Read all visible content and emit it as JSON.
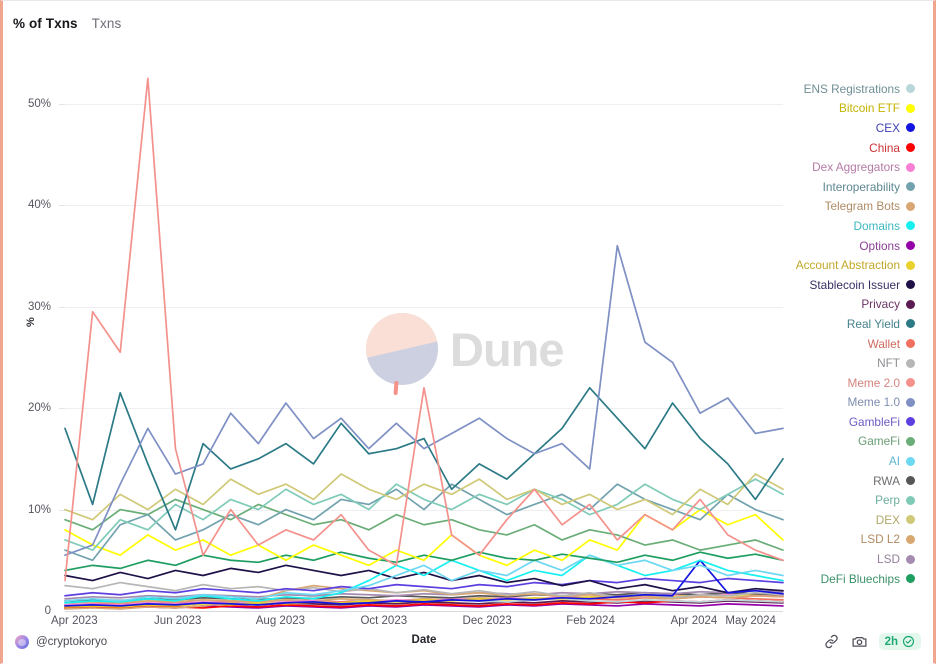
{
  "tabs": [
    {
      "label": "% of Txns",
      "active": true
    },
    {
      "label": "Txns",
      "active": false
    }
  ],
  "axes": {
    "y_label": "%",
    "x_label": "Date",
    "y_ticks": [
      "50%",
      "40%",
      "30%",
      "20%",
      "10%",
      "0"
    ],
    "x_ticks": [
      "Apr 2023",
      "Jun 2023",
      "Aug 2023",
      "Oct 2023",
      "Dec 2023",
      "Feb 2024",
      "Apr 2024",
      "May 2024"
    ]
  },
  "watermark": {
    "text": "Dune"
  },
  "footer": {
    "author": "@cryptokoryo",
    "avatar_icon": "avatar-icon",
    "share_icon": "share-link-icon",
    "camera_icon": "camera-icon",
    "freshness_label": "2h",
    "freshness_icon": "check-circle-icon"
  },
  "chart_data": {
    "type": "line",
    "title": "",
    "xlabel": "Date",
    "ylabel": "%",
    "ylim": [
      0,
      55
    ],
    "yticks": [
      0,
      10,
      20,
      30,
      40,
      50
    ],
    "grid": true,
    "legend_position": "right",
    "x": [
      "Apr 2023",
      "Apr 2023",
      "May 2023",
      "May 2023",
      "Jun 2023",
      "Jun 2023",
      "Jul 2023",
      "Jul 2023",
      "Aug 2023",
      "Aug 2023",
      "Sep 2023",
      "Sep 2023",
      "Oct 2023",
      "Oct 2023",
      "Nov 2023",
      "Nov 2023",
      "Dec 2023",
      "Dec 2023",
      "Jan 2024",
      "Jan 2024",
      "Feb 2024",
      "Feb 2024",
      "Mar 2024",
      "Mar 2024",
      "Apr 2024",
      "Apr 2024",
      "May 2024"
    ],
    "xtick_positions": [
      0.013,
      0.157,
      0.3,
      0.444,
      0.588,
      0.732,
      0.876,
      0.955
    ],
    "series": [
      {
        "name": "ENS Registrations",
        "color": "#b9d6da",
        "text_color": "#6f8f95",
        "values": [
          1.0,
          1.2,
          1.1,
          0.9,
          1.3,
          1.5,
          1.2,
          1.0,
          1.1,
          1.4,
          1.2,
          1.0,
          0.9,
          1.1,
          1.3,
          1.0,
          0.9,
          1.1,
          1.2,
          1.0,
          0.9,
          1.1,
          1.0,
          0.9,
          1.1,
          1.0,
          0.9
        ]
      },
      {
        "name": "Bitcoin ETF",
        "color": "#ffff00",
        "text_color": "#c3b400",
        "values": [
          8.0,
          6.5,
          5.5,
          7.5,
          6.0,
          7.0,
          5.5,
          6.5,
          5.0,
          6.5,
          5.5,
          4.5,
          6.0,
          5.0,
          7.5,
          5.5,
          4.5,
          6.0,
          5.0,
          7.0,
          6.0,
          9.5,
          8.0,
          10.0,
          8.5,
          9.5,
          7.0
        ]
      },
      {
        "name": "CEX",
        "color": "#1414e0",
        "text_color": "#3f3fb5",
        "values": [
          0.5,
          0.6,
          0.5,
          0.7,
          0.6,
          0.8,
          0.7,
          0.6,
          0.8,
          0.9,
          0.7,
          0.8,
          1.0,
          0.9,
          1.1,
          1.0,
          1.2,
          1.1,
          1.3,
          1.2,
          1.4,
          1.6,
          1.5,
          5.0,
          1.8,
          2.0,
          1.7
        ]
      },
      {
        "name": "China",
        "color": "#ff0000",
        "text_color": "#cc3333",
        "values": [
          0.3,
          0.4,
          0.3,
          0.5,
          0.4,
          0.3,
          0.5,
          0.4,
          0.6,
          0.5,
          0.4,
          0.6,
          0.5,
          0.7,
          0.6,
          0.5,
          0.7,
          0.6,
          0.8,
          0.7,
          0.9,
          0.8,
          1.0,
          0.9,
          1.1,
          1.0,
          0.9
        ]
      },
      {
        "name": "Dex Aggregators",
        "color": "#f97fd6",
        "text_color": "#b57ba5",
        "values": [
          0.6,
          0.7,
          0.6,
          0.8,
          0.7,
          0.9,
          0.8,
          0.7,
          0.9,
          1.0,
          0.8,
          0.9,
          1.1,
          1.0,
          1.2,
          1.1,
          1.3,
          1.2,
          1.4,
          1.3,
          1.5,
          1.4,
          1.6,
          1.5,
          1.7,
          1.6,
          1.5
        ]
      },
      {
        "name": "Interoperability",
        "color": "#72a2ae",
        "text_color": "#5d8792",
        "values": [
          6.0,
          5.0,
          8.5,
          9.5,
          7.0,
          8.0,
          9.5,
          8.5,
          10.0,
          9.0,
          11.0,
          10.5,
          12.0,
          10.0,
          12.5,
          11.0,
          9.5,
          10.5,
          11.5,
          10.0,
          12.5,
          11.0,
          10.0,
          9.0,
          11.5,
          10.0,
          9.0
        ]
      },
      {
        "name": "Telegram Bots",
        "color": "#d9a774",
        "text_color": "#b08c66",
        "values": [
          0.2,
          0.3,
          0.2,
          0.4,
          0.3,
          0.5,
          0.8,
          1.2,
          2.0,
          2.5,
          2.2,
          2.0,
          1.8,
          2.0,
          1.6,
          1.8,
          1.5,
          1.7,
          1.4,
          1.6,
          1.3,
          1.5,
          1.2,
          1.4,
          1.3,
          1.5,
          1.4
        ]
      },
      {
        "name": "Domains",
        "color": "#18f0f0",
        "text_color": "#3ab8bd",
        "values": [
          0.8,
          1.0,
          0.9,
          1.2,
          1.0,
          1.5,
          1.2,
          1.0,
          1.4,
          1.2,
          1.8,
          3.0,
          4.5,
          3.5,
          5.0,
          4.0,
          3.0,
          4.0,
          3.5,
          5.5,
          4.5,
          3.5,
          4.0,
          5.0,
          4.0,
          3.5,
          3.0
        ]
      },
      {
        "name": "Options",
        "color": "#9400a8",
        "text_color": "#8a3f95",
        "values": [
          0.3,
          0.4,
          0.3,
          0.4,
          0.3,
          0.5,
          0.4,
          0.3,
          0.5,
          0.4,
          0.3,
          0.5,
          0.4,
          0.6,
          0.5,
          0.4,
          0.6,
          0.5,
          0.7,
          0.6,
          0.5,
          0.7,
          0.6,
          0.5,
          0.7,
          0.6,
          0.5
        ]
      },
      {
        "name": "Account Abstraction",
        "color": "#ead02c",
        "text_color": "#c0a82a",
        "values": [
          0.4,
          0.5,
          0.4,
          0.6,
          0.5,
          0.7,
          0.6,
          0.8,
          0.7,
          0.9,
          0.8,
          1.0,
          0.9,
          1.1,
          1.0,
          1.2,
          1.1,
          1.3,
          1.2,
          1.4,
          1.3,
          1.5,
          1.4,
          1.6,
          1.5,
          1.7,
          1.6
        ]
      },
      {
        "name": "Stablecoin Issuer",
        "color": "#1e1148",
        "text_color": "#3a2f63",
        "values": [
          3.5,
          3.0,
          3.8,
          3.2,
          4.0,
          3.5,
          4.2,
          3.8,
          4.5,
          4.0,
          3.5,
          4.0,
          3.2,
          3.8,
          3.0,
          3.5,
          2.8,
          3.2,
          2.5,
          3.0,
          2.2,
          2.6,
          2.0,
          2.4,
          1.8,
          2.2,
          2.0
        ]
      },
      {
        "name": "Privacy",
        "color": "#5b1a52",
        "text_color": "#6c3566",
        "values": [
          0.5,
          0.6,
          0.5,
          0.7,
          0.6,
          0.8,
          0.7,
          0.6,
          0.8,
          0.7,
          0.6,
          0.8,
          0.7,
          0.9,
          0.8,
          0.7,
          0.9,
          0.8,
          1.0,
          0.9,
          0.8,
          1.0,
          0.9,
          0.8,
          1.0,
          0.9,
          0.8
        ]
      },
      {
        "name": "Real Yield",
        "color": "#2b7a86",
        "text_color": "#44818c",
        "values": [
          18.0,
          10.5,
          21.5,
          14.5,
          8.0,
          16.5,
          14.0,
          15.0,
          16.5,
          14.5,
          18.5,
          15.5,
          16.0,
          17.0,
          12.0,
          14.5,
          13.0,
          15.5,
          18.0,
          22.0,
          19.0,
          16.0,
          20.5,
          17.0,
          14.5,
          11.0,
          15.0
        ]
      },
      {
        "name": "Wallet",
        "color": "#f2705f",
        "text_color": "#cf6a5e",
        "values": [
          0.6,
          0.7,
          0.8,
          0.7,
          0.9,
          0.8,
          1.0,
          0.9,
          1.1,
          1.0,
          0.9,
          1.1,
          1.0,
          1.2,
          1.1,
          1.0,
          1.2,
          1.1,
          1.3,
          1.2,
          1.1,
          1.3,
          1.2,
          1.4,
          1.3,
          1.2,
          1.1
        ]
      },
      {
        "name": "NFT",
        "color": "#b6b6b6",
        "text_color": "#8e8e94",
        "values": [
          2.5,
          2.2,
          2.8,
          2.4,
          2.0,
          2.6,
          2.2,
          2.4,
          2.0,
          2.3,
          1.9,
          2.2,
          1.8,
          2.1,
          1.7,
          2.0,
          1.6,
          1.9,
          1.5,
          1.8,
          1.4,
          1.7,
          1.3,
          1.6,
          1.5,
          1.8,
          1.6
        ]
      },
      {
        "name": "Meme 2.0",
        "color": "#f4918c",
        "text_color": "#d4837f",
        "values": [
          3.0,
          29.5,
          25.5,
          52.5,
          16.0,
          5.5,
          10.0,
          6.5,
          8.0,
          7.0,
          9.5,
          6.0,
          4.5,
          22.0,
          7.5,
          5.5,
          9.0,
          12.0,
          8.5,
          10.5,
          7.0,
          9.5,
          8.0,
          11.0,
          7.5,
          6.0,
          5.0
        ]
      },
      {
        "name": "Meme 1.0",
        "color": "#7e90c4",
        "text_color": "#7f8dae",
        "values": [
          5.5,
          6.5,
          12.5,
          18.0,
          13.5,
          14.5,
          19.5,
          16.5,
          20.5,
          17.0,
          19.0,
          16.0,
          18.5,
          16.0,
          17.5,
          19.0,
          17.0,
          15.5,
          16.5,
          14.0,
          36.0,
          26.5,
          24.5,
          19.5,
          21.0,
          17.5,
          18.0
        ]
      },
      {
        "name": "GambleFi",
        "color": "#5d3fe0",
        "text_color": "#6f5bc4",
        "values": [
          1.5,
          1.8,
          1.6,
          2.0,
          1.8,
          2.2,
          2.0,
          1.8,
          2.2,
          2.0,
          2.4,
          2.2,
          2.6,
          2.4,
          2.2,
          2.6,
          2.4,
          2.8,
          2.6,
          3.0,
          2.8,
          3.2,
          3.0,
          2.8,
          3.2,
          3.0,
          2.8
        ]
      },
      {
        "name": "GameFi",
        "color": "#6aad77",
        "text_color": "#6b9e77",
        "values": [
          9.0,
          8.0,
          10.0,
          9.5,
          11.0,
          10.0,
          9.0,
          10.5,
          9.5,
          8.5,
          9.0,
          8.0,
          9.5,
          8.5,
          9.0,
          8.0,
          7.5,
          8.5,
          7.0,
          8.0,
          7.5,
          6.5,
          7.0,
          6.0,
          6.5,
          7.0,
          6.0
        ]
      },
      {
        "name": "AI",
        "color": "#6dd8f2",
        "text_color": "#5fb5cc",
        "values": [
          1.0,
          1.2,
          1.0,
          1.4,
          1.2,
          1.6,
          1.4,
          1.2,
          1.8,
          1.6,
          2.0,
          2.5,
          3.5,
          4.5,
          3.0,
          4.0,
          3.5,
          5.0,
          4.0,
          5.5,
          4.5,
          5.0,
          4.0,
          4.5,
          3.5,
          4.0,
          3.5
        ]
      },
      {
        "name": "RWA",
        "color": "#575757",
        "text_color": "#6e6e72",
        "values": [
          1.0,
          1.1,
          1.0,
          1.2,
          1.1,
          1.3,
          1.2,
          1.1,
          1.3,
          1.2,
          1.4,
          1.3,
          1.5,
          1.4,
          1.3,
          1.5,
          1.4,
          1.6,
          1.5,
          1.7,
          1.6,
          1.8,
          1.7,
          1.6,
          1.8,
          1.7,
          1.6
        ]
      },
      {
        "name": "Perp",
        "color": "#7fcbb8",
        "text_color": "#6fae9e",
        "values": [
          7.0,
          6.0,
          9.0,
          8.0,
          10.5,
          9.0,
          11.0,
          10.0,
          12.0,
          10.5,
          11.5,
          10.0,
          12.5,
          11.0,
          10.0,
          11.5,
          10.5,
          12.0,
          11.0,
          9.5,
          10.5,
          12.5,
          11.0,
          10.0,
          11.5,
          13.0,
          11.5
        ]
      },
      {
        "name": "DEX",
        "color": "#cfc978",
        "text_color": "#afa86a",
        "values": [
          10.0,
          9.0,
          11.5,
          10.0,
          12.0,
          10.5,
          13.0,
          11.5,
          12.5,
          11.0,
          13.5,
          12.0,
          11.0,
          12.5,
          11.5,
          13.0,
          11.0,
          12.0,
          10.5,
          11.5,
          10.0,
          11.0,
          9.5,
          12.0,
          10.5,
          13.5,
          12.0
        ]
      },
      {
        "name": "LSD L2",
        "color": "#d8a871",
        "text_color": "#b28b63",
        "values": [
          0.8,
          0.9,
          0.8,
          1.0,
          0.9,
          1.1,
          1.0,
          0.9,
          1.1,
          1.0,
          1.2,
          1.1,
          1.0,
          1.2,
          1.1,
          1.3,
          1.2,
          1.1,
          1.3,
          1.2,
          1.4,
          1.3,
          1.2,
          1.4,
          1.3,
          1.5,
          1.4
        ]
      },
      {
        "name": "LSD",
        "color": "#a58bb0",
        "text_color": "#94809c",
        "values": [
          1.2,
          1.4,
          1.3,
          1.5,
          1.4,
          1.6,
          1.5,
          1.4,
          1.6,
          1.5,
          1.7,
          1.6,
          1.5,
          1.7,
          1.6,
          1.8,
          1.7,
          1.6,
          1.8,
          1.7,
          1.9,
          1.8,
          1.7,
          1.9,
          1.8,
          2.0,
          1.9
        ]
      },
      {
        "name": "DeFi Bluechips",
        "color": "#1f9e61",
        "text_color": "#3b9169",
        "values": [
          4.0,
          4.5,
          4.2,
          5.0,
          4.5,
          5.5,
          5.0,
          4.8,
          5.5,
          5.0,
          5.8,
          5.2,
          4.8,
          5.5,
          5.0,
          5.8,
          5.2,
          5.0,
          5.6,
          5.2,
          4.8,
          5.5,
          5.0,
          5.8,
          5.2,
          5.6,
          5.0
        ]
      }
    ]
  }
}
